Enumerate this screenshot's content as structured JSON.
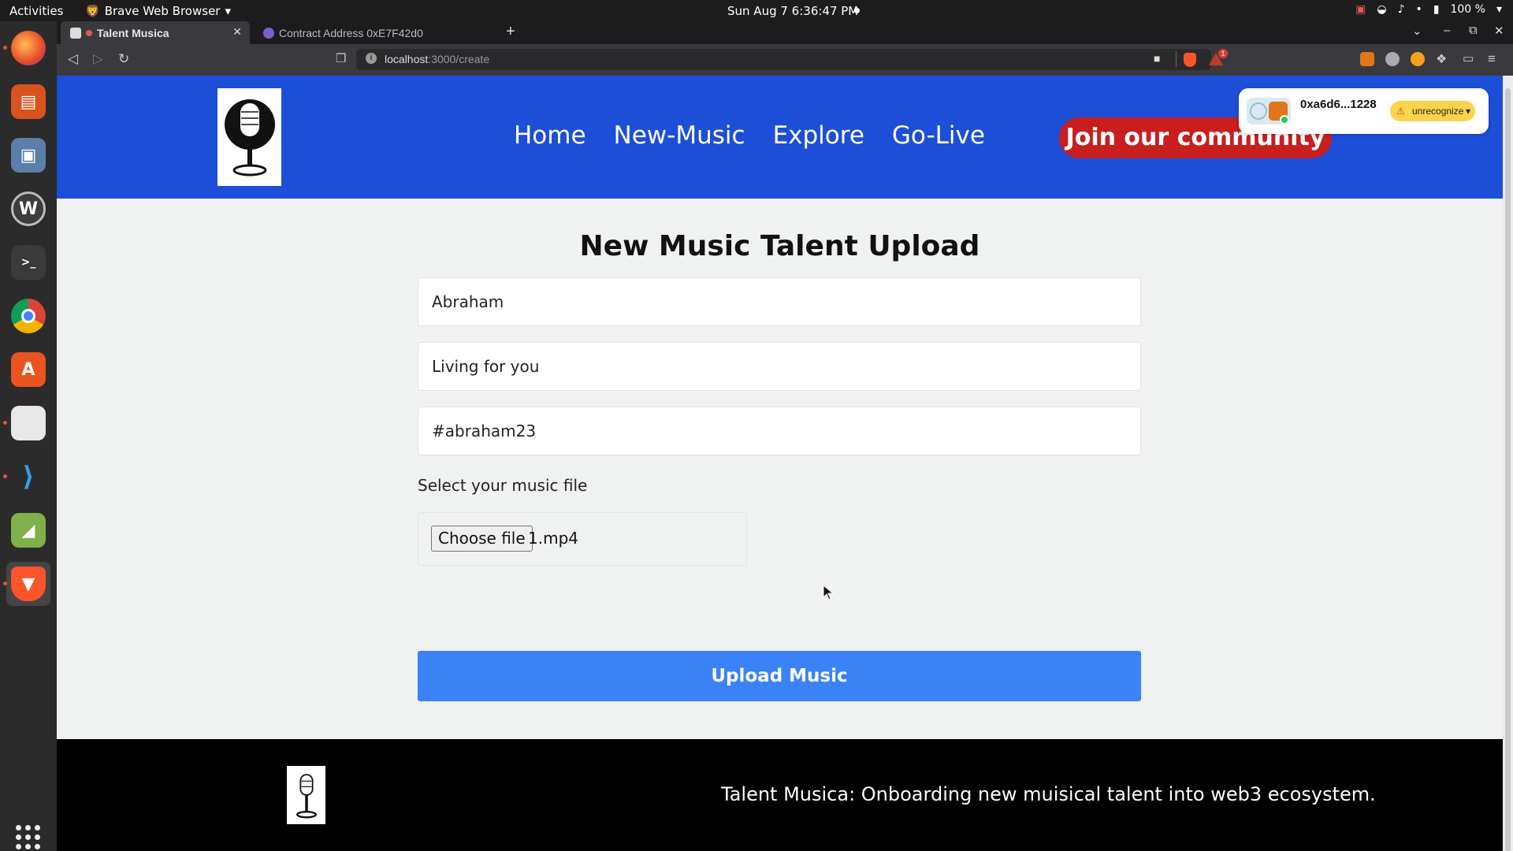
{
  "topbar": {
    "activities": "Activities",
    "app_name": "Brave Web Browser",
    "clock": "Sun Aug 7  6:36:47 PM",
    "battery": "100 %"
  },
  "dock": {
    "apps": [
      "firefox-icon",
      "impress-icon",
      "screenshot-icon",
      "webstorm-icon",
      "terminal-icon",
      "chrome-icon",
      "app-center-icon",
      "files-icon",
      "vscode-icon",
      "image-viewer-icon",
      "brave-icon"
    ]
  },
  "browser": {
    "tabs": [
      {
        "title": "Talent Musica"
      },
      {
        "title": "Contract Address 0xE7F42d0"
      }
    ],
    "url_host": "localhost",
    "url_path": ":3000/create",
    "notification_count": "1"
  },
  "site": {
    "nav": [
      "Home",
      "New-Music",
      "Explore",
      "Go-Live"
    ],
    "join_label": "Join our community",
    "wallet": {
      "address": "0xa6d6...1228",
      "network": "unrecognize"
    }
  },
  "form": {
    "title": "New Music Talent Upload",
    "name_value": "Abraham",
    "song_value": "Living for you",
    "tag_value": "#abraham23",
    "file_label": "Select your music file",
    "choose_label": "Choose file",
    "file_name": "1.mp4",
    "upload_label": "Upload Music"
  },
  "footer": {
    "tagline": "Talent Musica: Onboarding new muisical talent into web3 ecosystem."
  },
  "colors": {
    "header_bg": "#1d4ed8",
    "join_bg": "#c81e1e",
    "upload_bg": "#3b82f6",
    "page_bg": "#f0f2f1"
  }
}
